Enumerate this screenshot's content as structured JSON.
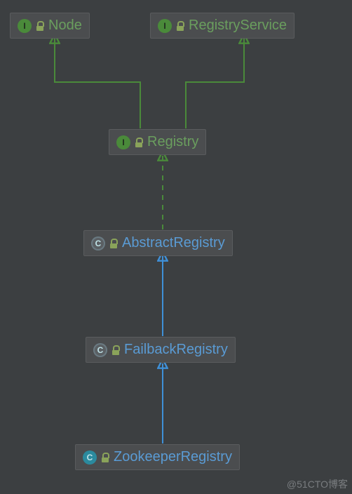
{
  "diagram": {
    "nodes": {
      "node": {
        "label": "Node",
        "icon_letter": "I",
        "type": "interface"
      },
      "registryService": {
        "label": "RegistryService",
        "icon_letter": "I",
        "type": "interface"
      },
      "registry": {
        "label": "Registry",
        "icon_letter": "I",
        "type": "interface"
      },
      "abstractRegistry": {
        "label": "AbstractRegistry",
        "icon_letter": "C",
        "type": "abstract-class"
      },
      "failbackRegistry": {
        "label": "FailbackRegistry",
        "icon_letter": "C",
        "type": "abstract-class"
      },
      "zookeeperRegistry": {
        "label": "ZookeeperRegistry",
        "icon_letter": "C",
        "type": "class"
      }
    },
    "edges": [
      {
        "from": "registry",
        "to": "node",
        "style": "implements"
      },
      {
        "from": "registry",
        "to": "registryService",
        "style": "implements"
      },
      {
        "from": "abstractRegistry",
        "to": "registry",
        "style": "implements-dashed"
      },
      {
        "from": "failbackRegistry",
        "to": "abstractRegistry",
        "style": "extends"
      },
      {
        "from": "zookeeperRegistry",
        "to": "failbackRegistry",
        "style": "extends"
      }
    ],
    "colors": {
      "implements": "#4a8a3a",
      "extends": "#3f90d8",
      "bg": "#3c3f41",
      "node_bg": "#4b4d4f"
    }
  },
  "watermark": "@51CTO博客"
}
